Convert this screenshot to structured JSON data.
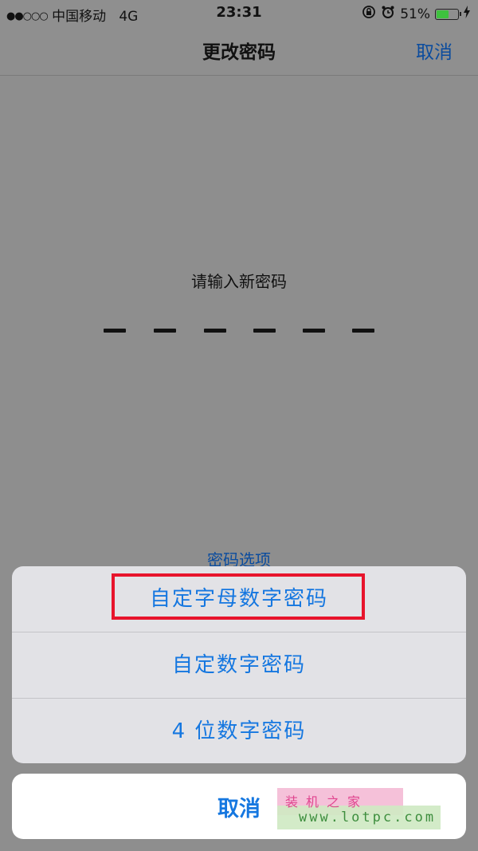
{
  "status_bar": {
    "signal": "●●○○○",
    "carrier": "中国移动",
    "network": "4G",
    "time": "23:31",
    "battery_percent": "51%",
    "battery_level": 0.51,
    "icons": [
      "rotation-lock-icon",
      "alarm-icon",
      "battery-icon",
      "charging-icon"
    ]
  },
  "navbar": {
    "title": "更改密码",
    "cancel": "取消"
  },
  "passcode": {
    "prompt": "请输入新密码",
    "digits": 6,
    "options_link": "密码选项"
  },
  "action_sheet": {
    "items": [
      {
        "label": "自定字母数字密码",
        "highlighted": true
      },
      {
        "label": "自定数字密码",
        "highlighted": false
      },
      {
        "label": "4 位数字密码",
        "highlighted": false
      }
    ],
    "cancel": "取消"
  },
  "watermark": {
    "line1": "装机之家",
    "line2": "www.lotpc.com"
  },
  "colors": {
    "accent": "#1577e0",
    "highlight": "#e8142c",
    "battery": "#3ec23e"
  }
}
